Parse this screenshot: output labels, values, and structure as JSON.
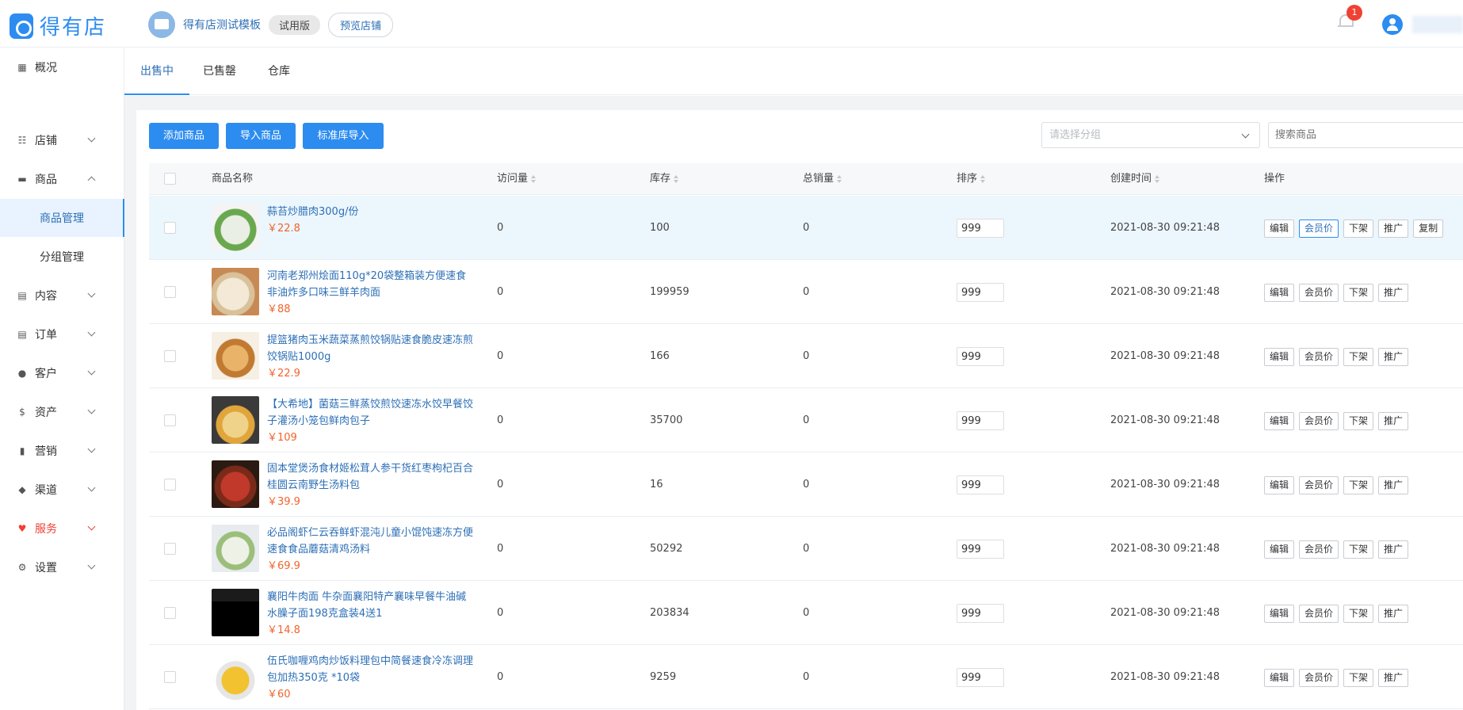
{
  "header": {
    "logo_text": "得有店",
    "shop_name": "得有店测试模板",
    "trial_label": "试用版",
    "preview_label": "预览店铺",
    "notification_count": "1"
  },
  "sidebar": {
    "items": [
      {
        "label": "概况",
        "icon": "grid-icon"
      },
      {
        "label": "店铺",
        "icon": "sliders-icon"
      },
      {
        "label": "商品",
        "icon": "box-icon"
      },
      {
        "label": "内容",
        "icon": "document-icon"
      },
      {
        "label": "订单",
        "icon": "list-icon"
      },
      {
        "label": "客户",
        "icon": "users-icon"
      },
      {
        "label": "资产",
        "icon": "dollar-icon"
      },
      {
        "label": "营销",
        "icon": "bar-chart-icon"
      },
      {
        "label": "渠道",
        "icon": "layers-icon"
      },
      {
        "label": "服务",
        "icon": "heart-icon"
      },
      {
        "label": "设置",
        "icon": "gear-icon"
      }
    ],
    "sub_items": [
      {
        "label": "商品管理"
      },
      {
        "label": "分组管理"
      }
    ]
  },
  "tabs": [
    {
      "label": "出售中"
    },
    {
      "label": "已售罄"
    },
    {
      "label": "仓库"
    }
  ],
  "toolbar": {
    "add_label": "添加商品",
    "import_label": "导入商品",
    "std_import_label": "标准库导入",
    "group_placeholder": "请选择分组",
    "search_placeholder": "搜索商品"
  },
  "table": {
    "headers": {
      "name": "商品名称",
      "visits": "访问量",
      "stock": "库存",
      "sales": "总销量",
      "sort": "排序",
      "created": "创建时间",
      "ops": "操作"
    },
    "op_labels": {
      "edit": "编辑",
      "member_price": "会员价",
      "off_shelf": "下架",
      "promote": "推广",
      "copy": "复制"
    },
    "rows": [
      {
        "name": "蒜苔炒腊肉300g/份",
        "price": "￥22.8",
        "visits": "0",
        "stock": "100",
        "sales": "0",
        "sort": "999",
        "created": "2021-08-30 09:21:48"
      },
      {
        "name": "河南老郑州烩面110g*20袋整箱装方便速食非油炸多口味三鲜羊肉面",
        "price": "￥88",
        "visits": "0",
        "stock": "199959",
        "sales": "0",
        "sort": "999",
        "created": "2021-08-30 09:21:48"
      },
      {
        "name": "提篮猪肉玉米蔬菜蒸煎饺锅贴速食脆皮速冻煎饺锅贴1000g",
        "price": "￥22.9",
        "visits": "0",
        "stock": "166",
        "sales": "0",
        "sort": "999",
        "created": "2021-08-30 09:21:48"
      },
      {
        "name": "【大希地】菌菇三鲜蒸饺煎饺速冻水饺早餐饺子灌汤小笼包鲜肉包子",
        "price": "￥109",
        "visits": "0",
        "stock": "35700",
        "sales": "0",
        "sort": "999",
        "created": "2021-08-30 09:21:48"
      },
      {
        "name": "固本堂煲汤食材姬松茸人参干货红枣枸杞百合桂圆云南野生汤料包",
        "price": "￥39.9",
        "visits": "0",
        "stock": "16",
        "sales": "0",
        "sort": "999",
        "created": "2021-08-30 09:21:48"
      },
      {
        "name": "必品阁虾仁云吞鲜虾混沌儿童小馄饨速冻方便速食食品蘑菇清鸡汤料",
        "price": "￥69.9",
        "visits": "0",
        "stock": "50292",
        "sales": "0",
        "sort": "999",
        "created": "2021-08-30 09:21:48"
      },
      {
        "name": "襄阳牛肉面 牛杂面襄阳特产襄味早餐牛油碱水臊子面198克盒装4送1",
        "price": "￥14.8",
        "visits": "0",
        "stock": "203834",
        "sales": "0",
        "sort": "999",
        "created": "2021-08-30 09:21:48"
      },
      {
        "name": "伍氏咖喱鸡肉炒饭料理包中简餐速食冷冻调理包加热350克 *10袋",
        "price": "￥60",
        "visits": "0",
        "stock": "9259",
        "sales": "0",
        "sort": "999",
        "created": "2021-08-30 09:21:48"
      }
    ]
  }
}
